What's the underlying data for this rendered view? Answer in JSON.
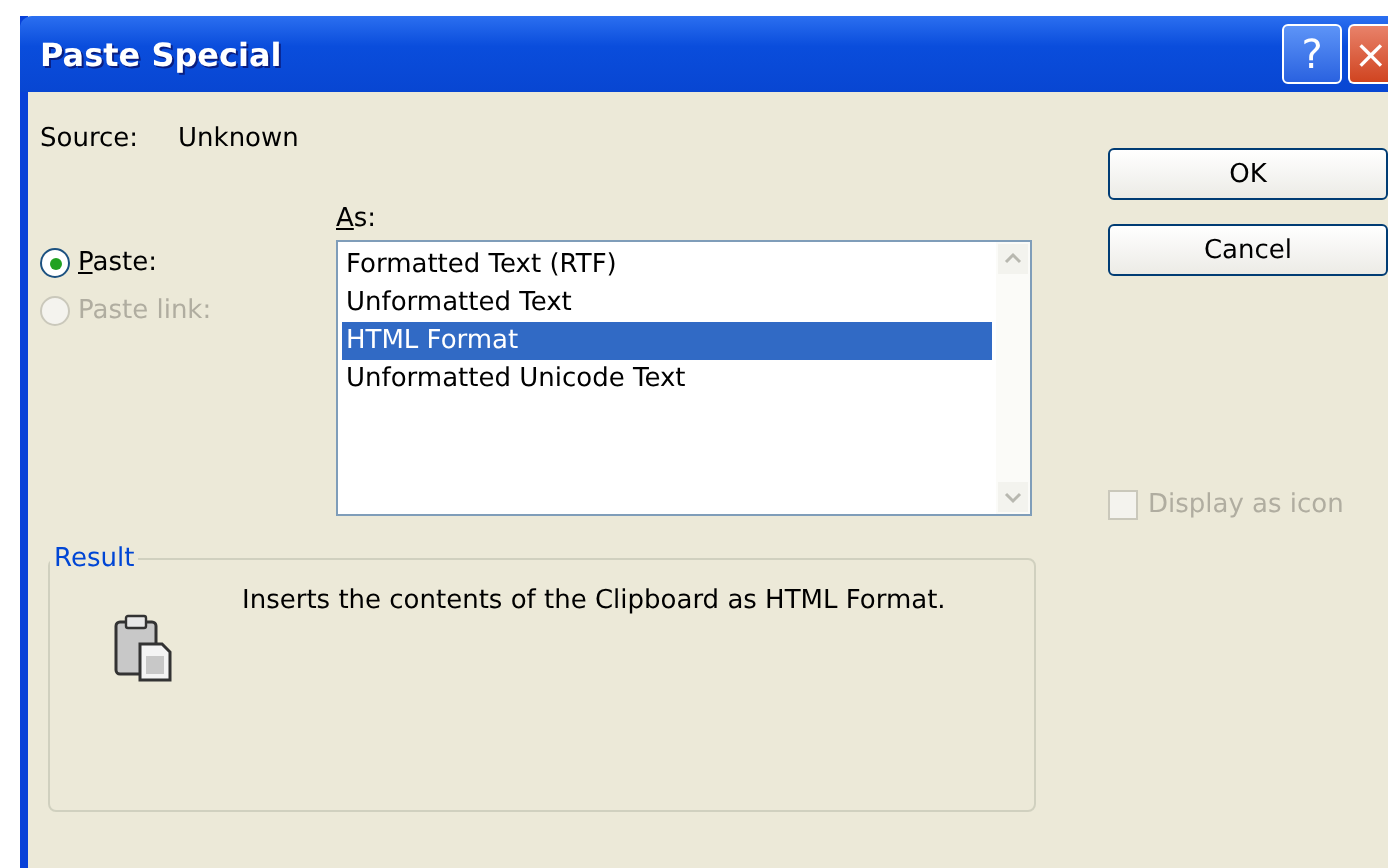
{
  "window": {
    "title": "Paste Special"
  },
  "title_buttons": [
    {
      "kind": "help",
      "label": "?"
    },
    {
      "kind": "close",
      "label": "×"
    }
  ],
  "source": {
    "label": "Source:",
    "value": "Unknown"
  },
  "paste_options": [
    {
      "label": "Paste:",
      "selected": true,
      "disabled": false
    },
    {
      "label": "Paste link:",
      "selected": false,
      "disabled": true
    }
  ],
  "as": {
    "label": "As:",
    "items": [
      {
        "label": "Formatted Text (RTF)",
        "selected": false
      },
      {
        "label": "Unformatted Text",
        "selected": false
      },
      {
        "label": "HTML Format",
        "selected": true
      },
      {
        "label": "Unformatted Unicode Text",
        "selected": false
      }
    ]
  },
  "buttons": [
    "OK",
    "Cancel"
  ],
  "display_as_icon": {
    "label": "Display as icon",
    "checked": false,
    "disabled": true
  },
  "result": {
    "title": "Result",
    "text": "Inserts the contents of the Clipboard as HTML Format."
  }
}
